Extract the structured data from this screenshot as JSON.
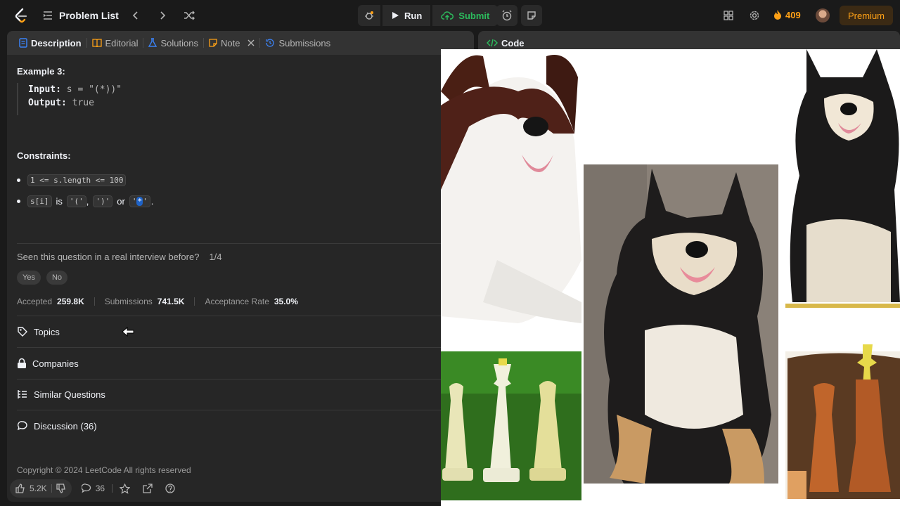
{
  "topbar": {
    "problem_list": "Problem List",
    "run": "Run",
    "submit": "Submit",
    "streak": "409",
    "premium": "Premium"
  },
  "tabs": [
    {
      "label": "Description"
    },
    {
      "label": "Editorial"
    },
    {
      "label": "Solutions"
    },
    {
      "label": "Note"
    },
    {
      "label": "Submissions"
    }
  ],
  "example": {
    "title": "Example 3:",
    "input_label": "Input:",
    "input_value": "s = \"(*))\"",
    "output_label": "Output:",
    "output_value": "true"
  },
  "constraints": {
    "title": "Constraints:",
    "c1": "1 <= s.length <= 100",
    "c2_code1": "s[i]",
    "c2_is": "is",
    "c2_code2": "'('",
    "c2_comma": ",",
    "c2_code3": "')'",
    "c2_or": "or",
    "c2_code4_a": "'",
    "c2_code4_b": "*",
    "c2_code4_c": "'",
    "c2_end": "."
  },
  "interview": {
    "question": "Seen this question in a real interview before?",
    "count": "1/4",
    "yes": "Yes",
    "no": "No"
  },
  "stats": {
    "accepted_label": "Accepted",
    "accepted_value": "259.8K",
    "submissions_label": "Submissions",
    "submissions_value": "741.5K",
    "rate_label": "Acceptance Rate",
    "rate_value": "35.0%"
  },
  "sections": {
    "topics": "Topics",
    "companies": "Companies",
    "similar": "Similar Questions",
    "discussion": "Discussion (36)"
  },
  "footer": {
    "copyright": "Copyright © 2024 LeetCode All rights reserved",
    "likes": "5.2K",
    "comments": "36"
  },
  "code_panel": {
    "title": "Code"
  },
  "colors": {
    "accent": "#ffa116",
    "submit_green": "#2cbb5d",
    "panel": "#262626",
    "tabbar": "#333333",
    "highlight": "#1f63c7"
  }
}
